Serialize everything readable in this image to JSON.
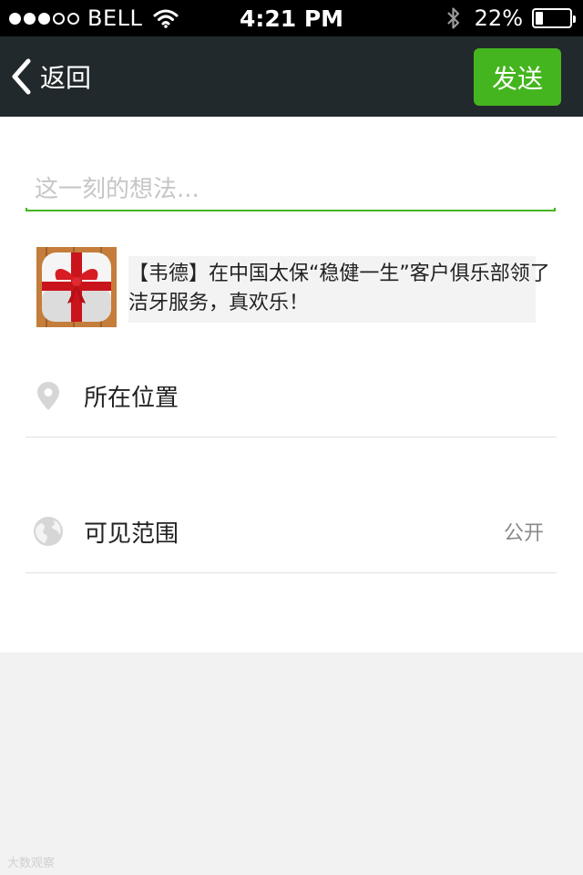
{
  "status_bar": {
    "carrier": "BELL",
    "signal_bars_filled": 3,
    "signal_bars_total": 5,
    "time": "4:21 PM",
    "battery_percent_label": "22%",
    "battery_level": 0.22,
    "icons": [
      "wifi-icon",
      "bluetooth-icon",
      "battery-icon"
    ]
  },
  "nav": {
    "back_label": "返回",
    "send_label": "发送",
    "accent_color": "#44b51e",
    "background_color": "#22292c"
  },
  "compose": {
    "placeholder": "这一刻的想法...",
    "value": ""
  },
  "share": {
    "thumbnail_icon": "gift-box-icon",
    "text": "【韦德】在中国太保“稳健一生”客户俱乐部领了洁牙服务，真欢乐！"
  },
  "options": {
    "location": {
      "label": "所在位置",
      "icon": "location-pin-icon"
    },
    "visibility": {
      "label": "可见范围",
      "value": "公开",
      "icon": "globe-icon"
    }
  },
  "watermark": "大数观察"
}
